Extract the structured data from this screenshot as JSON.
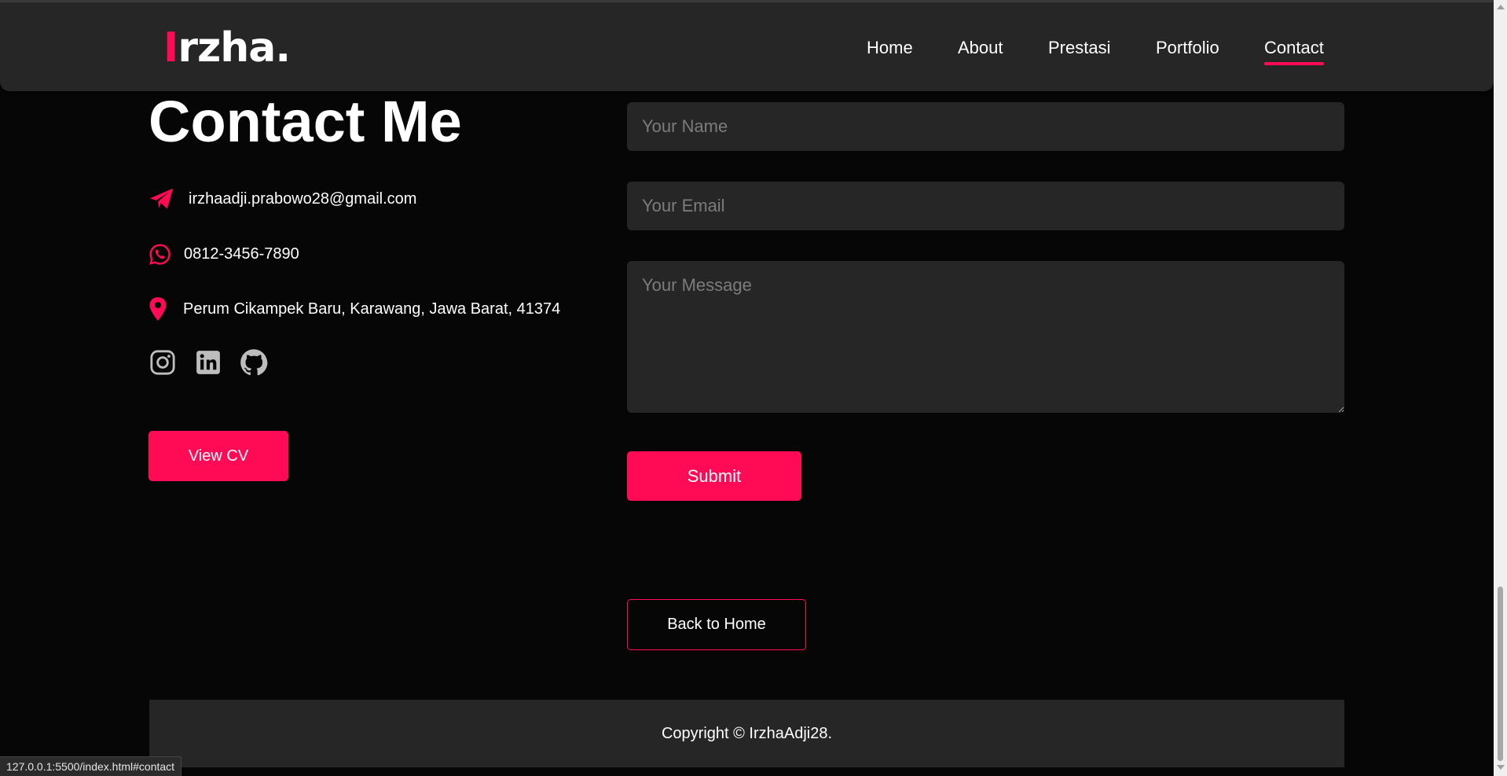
{
  "brand": {
    "accent_letter": "I",
    "rest": "rzha",
    "dot": ".",
    "accent_color": "#ff0a54"
  },
  "nav": {
    "items": [
      {
        "label": "Home"
      },
      {
        "label": "About"
      },
      {
        "label": "Prestasi"
      },
      {
        "label": "Portfolio"
      },
      {
        "label": "Contact",
        "active": true
      }
    ]
  },
  "contact": {
    "title": "Contact Me",
    "email": {
      "icon": "paper-plane-icon",
      "text": "irzhaadji.prabowo28@gmail.com"
    },
    "phone": {
      "icon": "whatsapp-icon",
      "text": "0812-3456-7890"
    },
    "address": {
      "icon": "map-pin-icon",
      "text": "Perum Cikampek Baru, Karawang, Jawa Barat, 41374"
    },
    "socials": [
      {
        "icon": "instagram-icon"
      },
      {
        "icon": "linkedin-icon"
      },
      {
        "icon": "github-icon"
      }
    ],
    "view_cv_label": "View CV"
  },
  "form": {
    "name_placeholder": "Your Name",
    "email_placeholder": "Your Email",
    "message_placeholder": "Your Message",
    "submit_label": "Submit"
  },
  "back_home_label": "Back to Home",
  "footer": {
    "copyright": "Copyright © IrzhaAdji28."
  },
  "status_url": "127.0.0.1:5500/index.html#contact",
  "colors": {
    "accent": "#ff0a54",
    "background": "#060606",
    "surface": "#262626"
  }
}
